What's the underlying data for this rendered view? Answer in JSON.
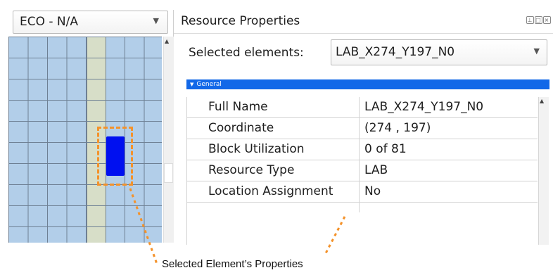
{
  "left_panel": {
    "eco_select": {
      "value": "ECO - N/A",
      "arrow_icon": "chevron-down-icon"
    }
  },
  "right_panel": {
    "title": "Resource Properties",
    "title_icons": [
      "pin-icon",
      "float-icon",
      "close-icon"
    ],
    "selected_elements": {
      "label": "Selected elements:",
      "value": "LAB_X274_Y197_N0"
    },
    "section": {
      "label": "General"
    },
    "properties": [
      {
        "key": "Full Name",
        "value": "LAB_X274_Y197_N0"
      },
      {
        "key": "Coordinate",
        "value": "(274 , 197)"
      },
      {
        "key": "Block Utilization",
        "value": "0 of 81"
      },
      {
        "key": "Resource Type",
        "value": "LAB"
      },
      {
        "key": "Location Assignment",
        "value": "No"
      }
    ]
  },
  "annotation": {
    "caption": "Selected Element’s Properties",
    "color": "#f4922a"
  },
  "colors": {
    "grid": "#b2cee9",
    "lab_column": "#d7dec8",
    "selected_block": "#0010f0",
    "section_bar": "#1268e8"
  }
}
